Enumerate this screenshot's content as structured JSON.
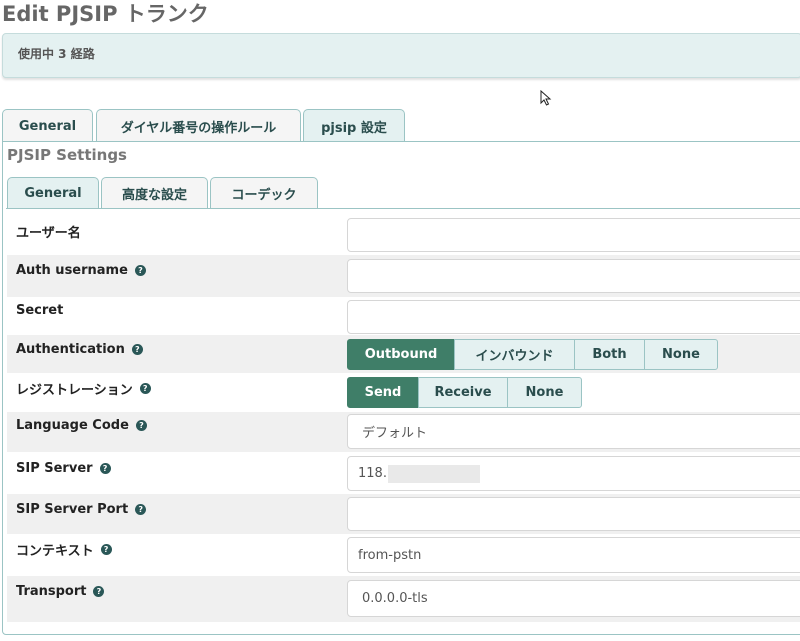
{
  "page": {
    "title": "Edit PJSIP トランク"
  },
  "usage": {
    "text": "使用中 3 経路"
  },
  "tabs": [
    {
      "label": "General"
    },
    {
      "label": "ダイヤル番号の操作ルール"
    },
    {
      "label": "pjsip 設定"
    }
  ],
  "section": {
    "title": "PJSIP Settings"
  },
  "inner_tabs": [
    {
      "label": "General"
    },
    {
      "label": "高度な設定"
    },
    {
      "label": "コーデック"
    }
  ],
  "fields": {
    "username": {
      "label": "ユーザー名",
      "value": ""
    },
    "auth_username": {
      "label": "Auth username",
      "value": ""
    },
    "secret": {
      "label": "Secret",
      "value": ""
    },
    "authentication": {
      "label": "Authentication",
      "options": [
        "Outbound",
        "インバウンド",
        "Both",
        "None"
      ],
      "selected": "Outbound"
    },
    "registration": {
      "label": "レジストレーション",
      "options": [
        "Send",
        "Receive",
        "None"
      ],
      "selected": "Send"
    },
    "language_code": {
      "label": "Language Code",
      "value": "デフォルト"
    },
    "sip_server": {
      "label": "SIP Server",
      "value": "118."
    },
    "sip_server_port": {
      "label": "SIP Server Port",
      "value": ""
    },
    "context": {
      "label": "コンテキスト",
      "value": "from-pstn"
    },
    "transport": {
      "label": "Transport",
      "value": "0.0.0.0-tls"
    }
  },
  "icons": {
    "help": "question-circle-icon",
    "help_glyph": "?"
  },
  "colors": {
    "accent": "#3f7e68",
    "tab_bg": "#e4f1f1",
    "border": "#9bc4c4"
  }
}
